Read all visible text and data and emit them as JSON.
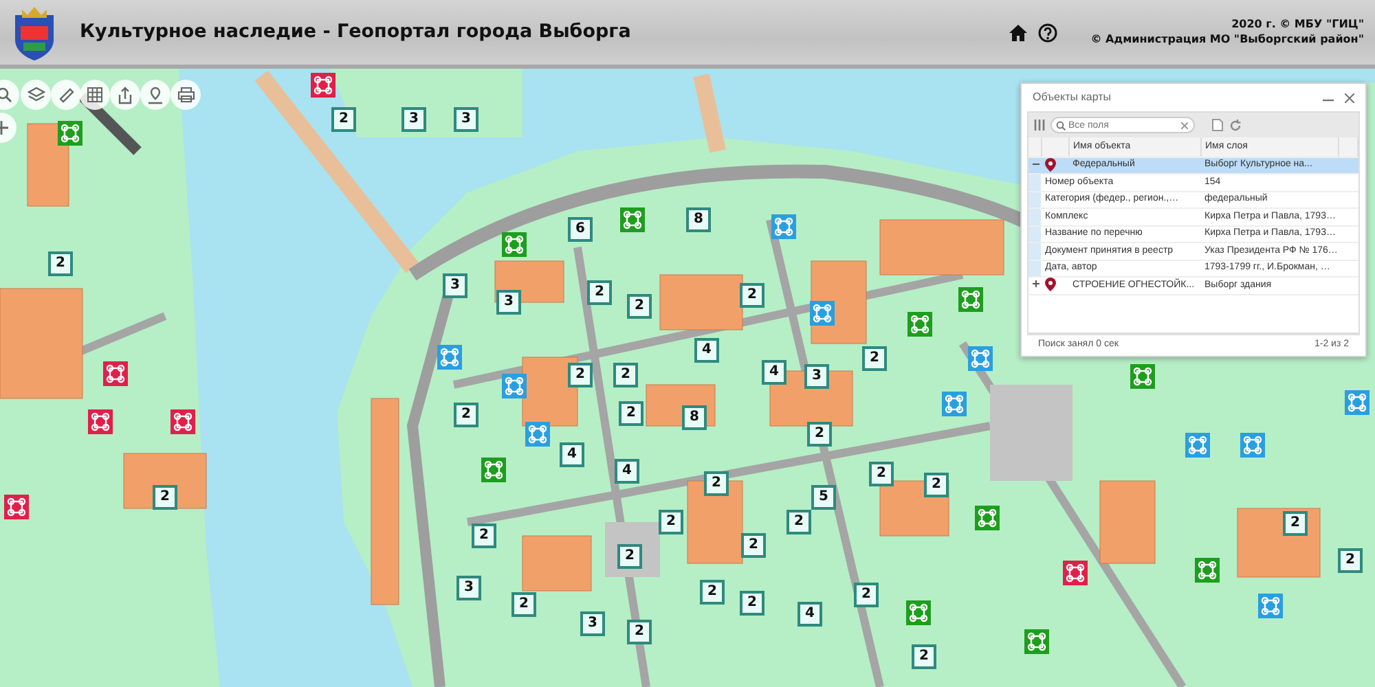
{
  "header": {
    "title": "Культурное наследие - Геопортал города Выборга",
    "copyright": [
      "2020 г. © МБУ \"ГИЦ\"",
      "© Администрация МО \"Выборгский район\""
    ]
  },
  "markers": [
    {
      "kind": "number",
      "label": "2"
    },
    {
      "kind": "number",
      "label": "3"
    },
    {
      "kind": "number",
      "label": "3"
    },
    {
      "kind": "number",
      "label": "2"
    },
    {
      "kind": "number",
      "label": "6"
    },
    {
      "kind": "number",
      "label": "8"
    },
    {
      "kind": "number",
      "label": "3"
    },
    {
      "kind": "number",
      "label": "3"
    },
    {
      "kind": "number",
      "label": "2"
    },
    {
      "kind": "number",
      "label": "2"
    },
    {
      "kind": "number",
      "label": "2"
    },
    {
      "kind": "number",
      "label": "4"
    },
    {
      "kind": "number",
      "label": "2"
    },
    {
      "kind": "number",
      "label": "2"
    },
    {
      "kind": "number",
      "label": "4"
    },
    {
      "kind": "number",
      "label": "3"
    },
    {
      "kind": "number",
      "label": "2"
    },
    {
      "kind": "number",
      "label": "2"
    },
    {
      "kind": "number",
      "label": "2"
    },
    {
      "kind": "number",
      "label": "8"
    },
    {
      "kind": "number",
      "label": "2"
    },
    {
      "kind": "number",
      "label": "4"
    },
    {
      "kind": "number",
      "label": "4"
    },
    {
      "kind": "number",
      "label": "2"
    },
    {
      "kind": "number",
      "label": "2"
    },
    {
      "kind": "number",
      "label": "2"
    },
    {
      "kind": "number",
      "label": "2"
    },
    {
      "kind": "number",
      "label": "5"
    },
    {
      "kind": "number",
      "label": "2"
    },
    {
      "kind": "number",
      "label": "2"
    },
    {
      "kind": "number",
      "label": "2"
    },
    {
      "kind": "number",
      "label": "2"
    },
    {
      "kind": "number",
      "label": "2"
    },
    {
      "kind": "number",
      "label": "2"
    },
    {
      "kind": "number",
      "label": "2"
    },
    {
      "kind": "number",
      "label": "3"
    },
    {
      "kind": "number",
      "label": "2"
    },
    {
      "kind": "number",
      "label": "2"
    },
    {
      "kind": "number",
      "label": "2"
    },
    {
      "kind": "number",
      "label": "2"
    },
    {
      "kind": "number",
      "label": "4"
    },
    {
      "kind": "number",
      "label": "3"
    },
    {
      "kind": "number",
      "label": "2"
    },
    {
      "kind": "number",
      "label": "2"
    },
    {
      "kind": "symbol",
      "color": "#1e9e1e"
    },
    {
      "kind": "symbol",
      "color": "#1e9e1e"
    },
    {
      "kind": "symbol",
      "color": "#1e9e1e"
    },
    {
      "kind": "symbol",
      "color": "#1e9e1e"
    },
    {
      "kind": "symbol",
      "color": "#1e9e1e"
    },
    {
      "kind": "symbol",
      "color": "#1e9e1e"
    },
    {
      "kind": "symbol",
      "color": "#1e9e1e"
    },
    {
      "kind": "symbol",
      "color": "#1e9e1e"
    },
    {
      "kind": "symbol",
      "color": "#1e9e1e"
    },
    {
      "kind": "symbol",
      "color": "#1e9e1e"
    },
    {
      "kind": "symbol",
      "color": "#1e9e1e"
    },
    {
      "kind": "symbol",
      "color": "#2a9fe0"
    },
    {
      "kind": "symbol",
      "color": "#2a9fe0"
    },
    {
      "kind": "symbol",
      "color": "#2a9fe0"
    },
    {
      "kind": "symbol",
      "color": "#2a9fe0"
    },
    {
      "kind": "symbol",
      "color": "#2a9fe0"
    },
    {
      "kind": "symbol",
      "color": "#2a9fe0"
    },
    {
      "kind": "symbol",
      "color": "#2a9fe0"
    },
    {
      "kind": "symbol",
      "color": "#2a9fe0"
    },
    {
      "kind": "symbol",
      "color": "#2a9fe0"
    },
    {
      "kind": "symbol",
      "color": "#2a9fe0"
    },
    {
      "kind": "symbol",
      "color": "#2a9fe0"
    },
    {
      "kind": "symbol",
      "color": "#e0204a"
    },
    {
      "kind": "symbol",
      "color": "#e0204a"
    },
    {
      "kind": "symbol",
      "color": "#e0204a"
    },
    {
      "kind": "symbol",
      "color": "#e0204a"
    },
    {
      "kind": "symbol",
      "color": "#e0204a"
    },
    {
      "kind": "symbol",
      "color": "#e0204a"
    }
  ],
  "panel": {
    "title": "Объекты карты",
    "search": {
      "placeholder": "Все поля"
    },
    "columns": [
      "Имя объекта",
      "Имя слоя"
    ],
    "rows": [
      {
        "name": "Федеральный",
        "layer": "Выборг Культурное на...",
        "expanded": true,
        "selected": true,
        "attributes": [
          {
            "key": "Номер объекта",
            "value": "154"
          },
          {
            "key": "Категория (федер., регион.,…",
            "value": "федеральный"
          },
          {
            "key": "Комплекс",
            "value": "Кирха Петра и Павла, 1793…"
          },
          {
            "key": "Название по перечню",
            "value": "Кирха Петра и Павла, 1793…"
          },
          {
            "key": "Документ принятия в реестр",
            "value": "Указ Президента РФ № 176…"
          },
          {
            "key": "Дата, автор",
            "value": "1793-1799 гг., И.Брокман, …"
          }
        ]
      },
      {
        "name": "СТРОЕНИЕ ОГНЕСТОЙК...",
        "layer": "Выборг здания",
        "expanded": false,
        "selected": false
      }
    ],
    "status": "Поиск занял 0 сек",
    "count": "1-2 из 2"
  }
}
